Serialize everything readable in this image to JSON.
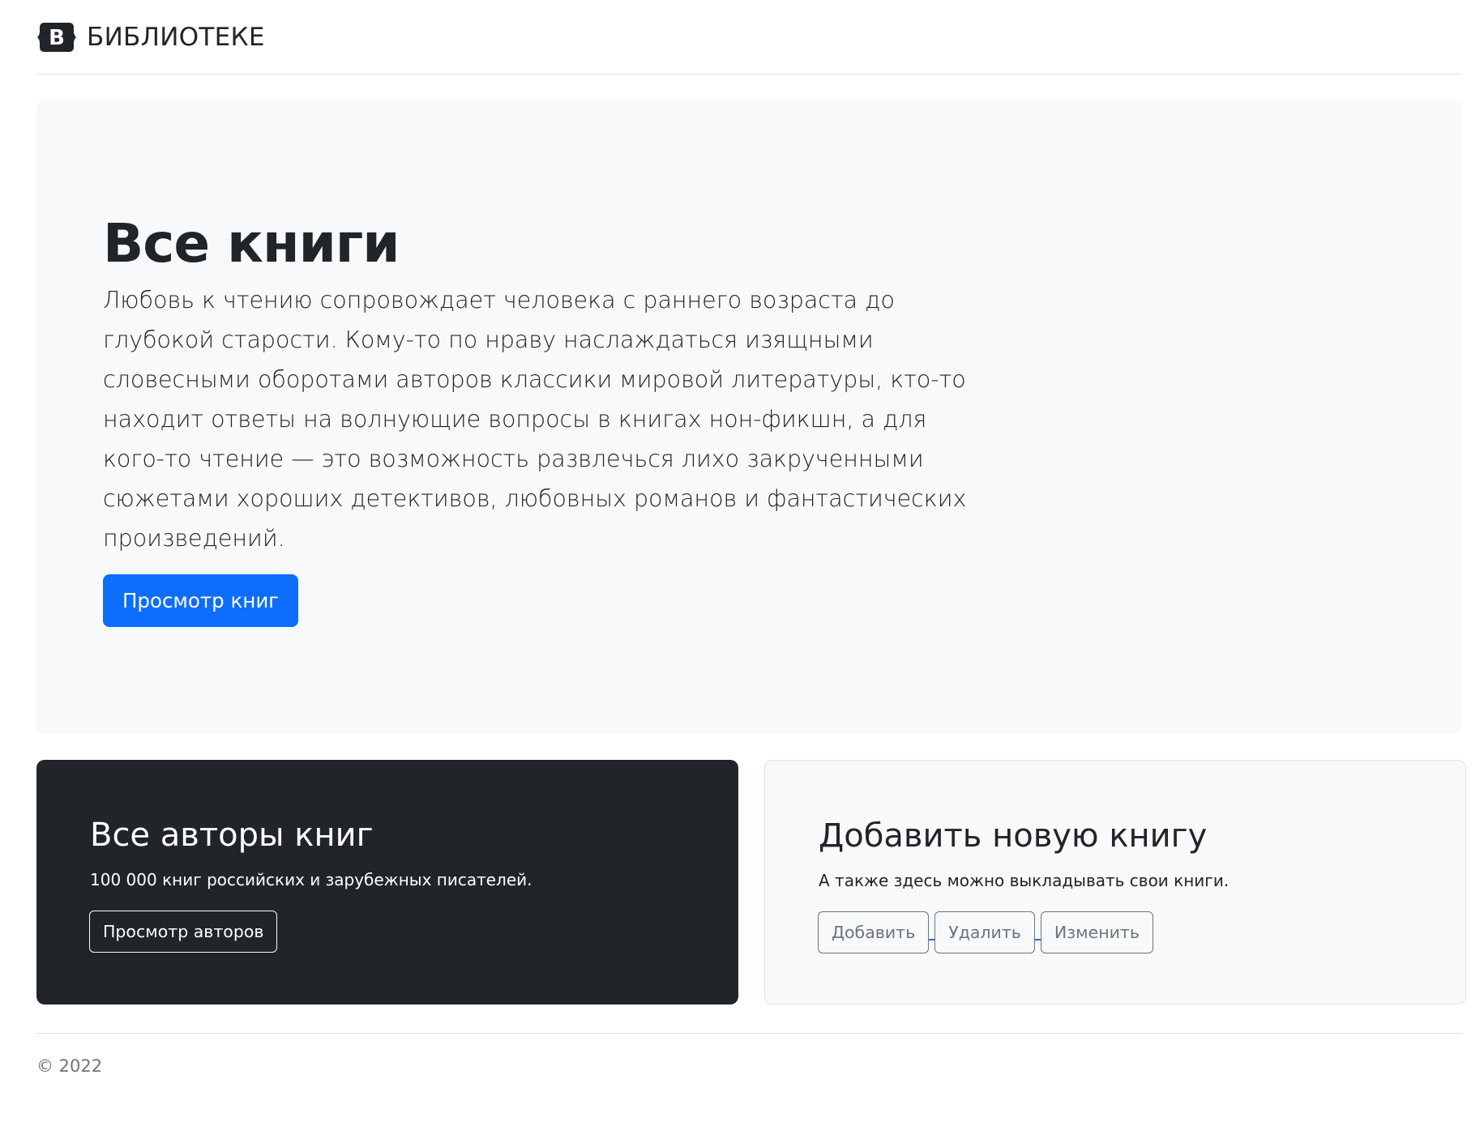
{
  "header": {
    "brand_letter": "B",
    "brand_text": "БИБЛИОТЕКЕ"
  },
  "hero": {
    "title": "Все книги",
    "lead": "Любовь к чтению сопровождает человека с раннего возраста до глубокой старости. Кому-то по нраву наслаждаться изящными словесными оборотами авторов классики мировой литературы, кто-то находит ответы на волнующие вопросы в книгах нон-фикшн, а для кого-то чтение — это возможность развлечься лихо закрученными сюжетами хороших детективов, любовных романов и фантастических произведений.",
    "button_label": "Просмотр книг"
  },
  "authors_card": {
    "title": "Все авторы книг",
    "text": "100 000 книг российских и зарубежных писателей.",
    "button_label": "Просмотр авторов"
  },
  "add_book_card": {
    "title": "Добавить новую книгу",
    "text": "А также здесь можно выкладывать свои книги.",
    "buttons": [
      {
        "label": "Добавить"
      },
      {
        "label": "Удалить"
      },
      {
        "label": "Изменить"
      }
    ]
  },
  "footer": {
    "copyright": "© 2022"
  },
  "colors": {
    "primary": "#0d6efd",
    "dark": "#212529",
    "light": "#f8f9fa",
    "secondary": "#6c757d",
    "border": "#dee2e6"
  },
  "icons": {
    "brand_logo": "bootstrap-logo-icon"
  }
}
